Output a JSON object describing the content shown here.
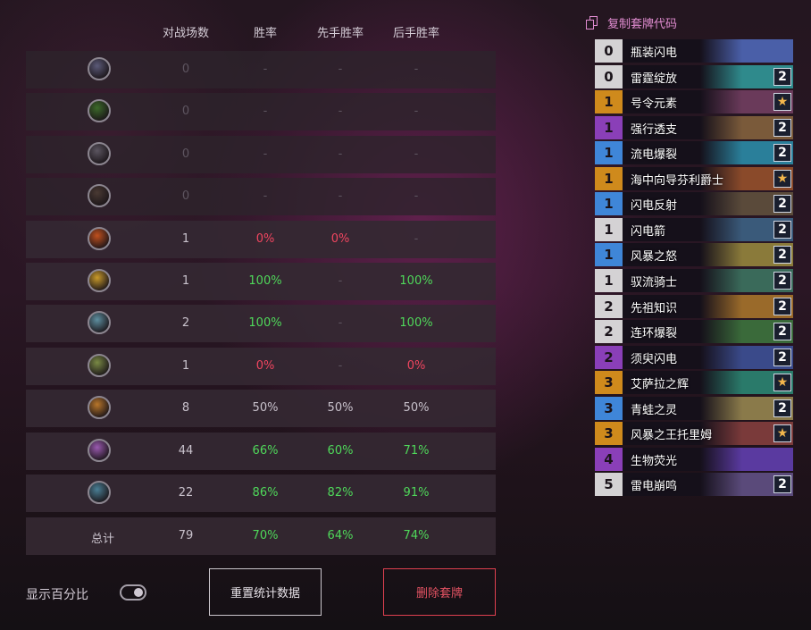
{
  "headers": {
    "games": "对战场数",
    "winrate": "胜率",
    "first": "先手胜率",
    "second": "后手胜率"
  },
  "rows": [
    {
      "icon": "deathknight-class-icon",
      "color": "#5b5a78",
      "games": "0",
      "win": "-",
      "first": "-",
      "second": "-",
      "ws": "dim",
      "fs": "dim",
      "ss": "dim"
    },
    {
      "icon": "demonhunter-class-icon",
      "color": "#3c6a2a",
      "games": "0",
      "win": "-",
      "first": "-",
      "second": "-",
      "ws": "dim",
      "fs": "dim",
      "ss": "dim"
    },
    {
      "icon": "druid-class-icon",
      "color": "#5b5560",
      "games": "0",
      "win": "-",
      "first": "-",
      "second": "-",
      "ws": "dim",
      "fs": "dim",
      "ss": "dim"
    },
    {
      "icon": "hunter-class-icon",
      "color": "#4a3a33",
      "games": "0",
      "win": "-",
      "first": "-",
      "second": "-",
      "ws": "dim",
      "fs": "dim",
      "ss": "dim"
    },
    {
      "icon": "mage-class-icon",
      "color": "#c0501e",
      "games": "1",
      "win": "0%",
      "first": "0%",
      "second": "-",
      "ws": "red",
      "fs": "red",
      "ss": "dim"
    },
    {
      "icon": "paladin-class-icon",
      "color": "#c99a2a",
      "games": "1",
      "win": "100%",
      "first": "-",
      "second": "100%",
      "ws": "green",
      "fs": "dim",
      "ss": "green"
    },
    {
      "icon": "priest-class-icon",
      "color": "#5e8fa0",
      "games": "2",
      "win": "100%",
      "first": "-",
      "second": "100%",
      "ws": "green",
      "fs": "dim",
      "ss": "green"
    },
    {
      "icon": "rogue-class-icon",
      "color": "#7a8a45",
      "games": "1",
      "win": "0%",
      "first": "-",
      "second": "0%",
      "ws": "red",
      "fs": "dim",
      "ss": "red"
    },
    {
      "icon": "shaman-class-icon",
      "color": "#b8762a",
      "games": "8",
      "win": "50%",
      "first": "50%",
      "second": "50%",
      "ws": "norm",
      "fs": "norm",
      "ss": "norm"
    },
    {
      "icon": "warlock-class-icon",
      "color": "#9a5ab0",
      "games": "44",
      "win": "66%",
      "first": "60%",
      "second": "71%",
      "ws": "green",
      "fs": "green",
      "ss": "green"
    },
    {
      "icon": "warrior-class-icon",
      "color": "#4a7f95",
      "games": "22",
      "win": "86%",
      "first": "82%",
      "second": "91%",
      "ws": "green",
      "fs": "green",
      "ss": "green"
    }
  ],
  "total": {
    "label": "总计",
    "games": "79",
    "win": "70%",
    "first": "64%",
    "second": "74%"
  },
  "show_percent_label": "显示百分比",
  "reset_label": "重置统计数据",
  "delete_label": "删除套牌",
  "copy_label": "复制套牌代码",
  "cards": [
    {
      "cost": "0",
      "rarity": "common",
      "name": "瓶装闪电",
      "count": "",
      "art": "#4a5fa8"
    },
    {
      "cost": "0",
      "rarity": "common",
      "name": "雷霆绽放",
      "count": "2",
      "art": "#2f8a8c"
    },
    {
      "cost": "1",
      "rarity": "legendary",
      "name": "号令元素",
      "count": "★",
      "art": "#6a3a5a"
    },
    {
      "cost": "1",
      "rarity": "epic",
      "name": "强行透支",
      "count": "2",
      "art": "#7a5a3a"
    },
    {
      "cost": "1",
      "rarity": "rare",
      "name": "流电爆裂",
      "count": "2",
      "art": "#2a7f9a"
    },
    {
      "cost": "1",
      "rarity": "legendary",
      "name": "海中向导芬利爵士",
      "count": "★",
      "art": "#8a4a2a"
    },
    {
      "cost": "1",
      "rarity": "rare",
      "name": "闪电反射",
      "count": "2",
      "art": "#5a4a3a"
    },
    {
      "cost": "1",
      "rarity": "common",
      "name": "闪电箭",
      "count": "2",
      "art": "#3a5a7a"
    },
    {
      "cost": "1",
      "rarity": "rare",
      "name": "风暴之怒",
      "count": "2",
      "art": "#8a7a3a"
    },
    {
      "cost": "1",
      "rarity": "common",
      "name": "驭流骑士",
      "count": "2",
      "art": "#3a6a5a"
    },
    {
      "cost": "2",
      "rarity": "common",
      "name": "先祖知识",
      "count": "2",
      "art": "#9a6a2a"
    },
    {
      "cost": "2",
      "rarity": "common",
      "name": "连环爆裂",
      "count": "2",
      "art": "#3a6a3a"
    },
    {
      "cost": "2",
      "rarity": "epic",
      "name": "须臾闪电",
      "count": "2",
      "art": "#3a4a8a"
    },
    {
      "cost": "3",
      "rarity": "legendary",
      "name": "艾萨拉之辉",
      "count": "★",
      "art": "#2a7a6a"
    },
    {
      "cost": "3",
      "rarity": "rare",
      "name": "青蛙之灵",
      "count": "2",
      "art": "#8a7a4a"
    },
    {
      "cost": "3",
      "rarity": "legendary",
      "name": "风暴之王托里姆",
      "count": "★",
      "art": "#7a3a3a"
    },
    {
      "cost": "4",
      "rarity": "epic",
      "name": "生物荧光",
      "count": "",
      "art": "#5a3aa0"
    },
    {
      "cost": "5",
      "rarity": "common",
      "name": "雷电崩鸣",
      "count": "2",
      "art": "#5a4a7a"
    }
  ],
  "rarity_colors": {
    "common": "#d4d2d4",
    "rare": "#3f86d8",
    "epic": "#8a3fb8",
    "legendary": "#cf8a1c"
  }
}
